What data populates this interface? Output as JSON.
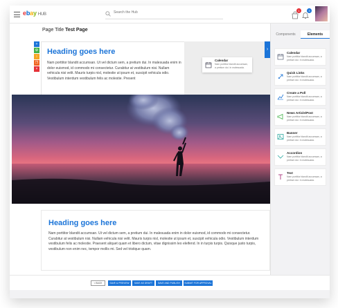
{
  "header": {
    "logo_letters": [
      "e",
      "b",
      "a",
      "y"
    ],
    "logo_suffix": "HUB",
    "search_placeholder": "Search the Hub",
    "cart_badge": "1",
    "notif_badge": "3",
    "colors": {
      "accent": "#1b74d8",
      "badge_red": "#e53238",
      "badge_blue": "#1b74d8"
    }
  },
  "editor": {
    "page_title_label": "Page Title",
    "page_title_value": "Test Page",
    "tool_icons": [
      "plus-icon",
      "settings-icon",
      "move-icon",
      "copy-icon",
      "delete-icon"
    ],
    "block1": {
      "heading": "Heading goes here",
      "body": "Nam porttitor blandit accumsan. Ut vel dictum sem, a pretium dui. In malesuada enim in dolor euismod, id commodo mi consectetur. Curabitur at vestibulum nisi. Nullam vehicula nisi velit. Mauris turpis nisl, molestie ut ipsum et, suscipit vehicula odio. Vestibulum interdum vestibulum felis ac molestie. Present"
    },
    "drag_card": {
      "title": "Calendar",
      "desc": "Nam porttitor blandit accumsan, a pretium dui. In malesuada."
    },
    "hero_image": "sunset-smoke-flare-photo",
    "block2": {
      "heading": "Heading goes here",
      "body": "Nam porttitor blandit accumsan. Ut vel dictum sem, a pretium dui. In malesuada enim in dolor euismod, id commodo mi consectetur. Curabitur at vestibulum nisi. Nullam vehicula nisi velit. Mauris turpis nisl, molestie ut ipsum et, suscipit vehicula odio. Vestibulum interdum vestibulum felis ac molestie. Praesent aliquet quam et libero dictum, vitae dignissim leo eleifend. In in turpis turpis. Quisque justo turpis, vestibulum non enim nec, tempor mollis mi. Sed vel tristique quam."
    }
  },
  "actions": {
    "back": "< Back",
    "save_preview": "Save & Preview",
    "save_draft": "Save as Draft",
    "save_publish": "Save and Publish",
    "submit": "Submit for Approval"
  },
  "panel": {
    "tabs": [
      "Components",
      "Elements"
    ],
    "active_tab": "Elements",
    "items": [
      {
        "title": "Calendar",
        "desc": "Nam porttitor blandit accumsan, a pretium dui. In malesuada.",
        "icon": "calendar-icon"
      },
      {
        "title": "Quick Links",
        "desc": "Nam porttitor blandit accumsan, a pretium dui. In malesuada.",
        "icon": "rocket-icon"
      },
      {
        "title": "Create a Poll",
        "desc": "Nam porttitor blandit accumsan, a pretium dui. In malesuada.",
        "icon": "poll-icon"
      },
      {
        "title": "News Article/Post",
        "desc": "Nam porttitor blandit accumsan, a pretium dui. In malesuada.",
        "icon": "megaphone-icon"
      },
      {
        "title": "Banner",
        "desc": "Nam porttitor blandit accumsan, a pretium dui. In malesuada.",
        "icon": "banner-icon"
      },
      {
        "title": "Accordion",
        "desc": "Nam porttitor blandit accumsan, a pretium dui. In malesuada.",
        "icon": "accordion-icon"
      },
      {
        "title": "Text",
        "desc": "Nam porttitor blandit accumsan, a pretium dui. In malesuada.",
        "icon": "text-icon"
      }
    ]
  }
}
